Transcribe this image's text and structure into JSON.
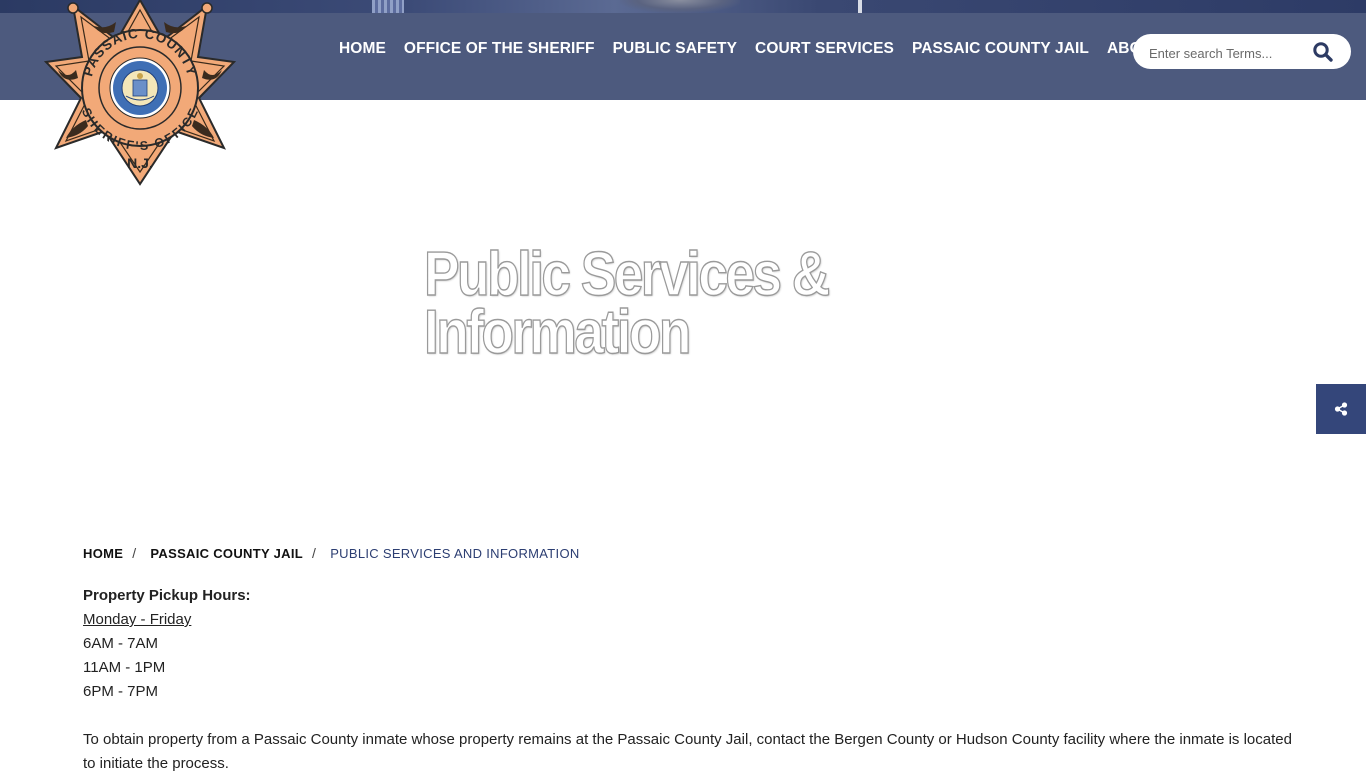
{
  "logo": {
    "text_top": "PASSAIC COUNTY",
    "text_bottom": "SHERIFF'S OFFICE",
    "text_state": "N.J.",
    "seal_text": "STATE OF NEW JERSEY"
  },
  "nav": {
    "items": [
      {
        "label": "HOME"
      },
      {
        "label": "OFFICE OF THE SHERIFF"
      },
      {
        "label": "PUBLIC SAFETY"
      },
      {
        "label": "COURT SERVICES"
      },
      {
        "label": "PASSAIC COUNTY JAIL"
      },
      {
        "label": "ABOUT US"
      }
    ]
  },
  "search": {
    "placeholder": "Enter search Terms...",
    "icon": "search-icon"
  },
  "hero": {
    "title_line1": "Public Services &",
    "title_line2": "Information"
  },
  "share": {
    "icon": "share-icon"
  },
  "breadcrumb": {
    "home": "HOME",
    "parent": "PASSAIC COUNTY JAIL",
    "current": "PUBLIC SERVICES AND INFORMATION",
    "separator": "/"
  },
  "content": {
    "heading": "Property Pickup Hours:",
    "days": "Monday - Friday",
    "hours": [
      "6AM - 7AM",
      "11AM - 1PM",
      "6PM - 7PM"
    ],
    "paragraph": "To obtain property from a Passaic County inmate whose property remains at the Passaic County Jail, contact the Bergen County or Hudson County facility where the inmate is located to initiate the process."
  },
  "colors": {
    "navbar": "#4d5a7e",
    "share_tab": "#34467a",
    "badge_fill": "#f2a978",
    "breadcrumb_current": "#2c3e72"
  }
}
